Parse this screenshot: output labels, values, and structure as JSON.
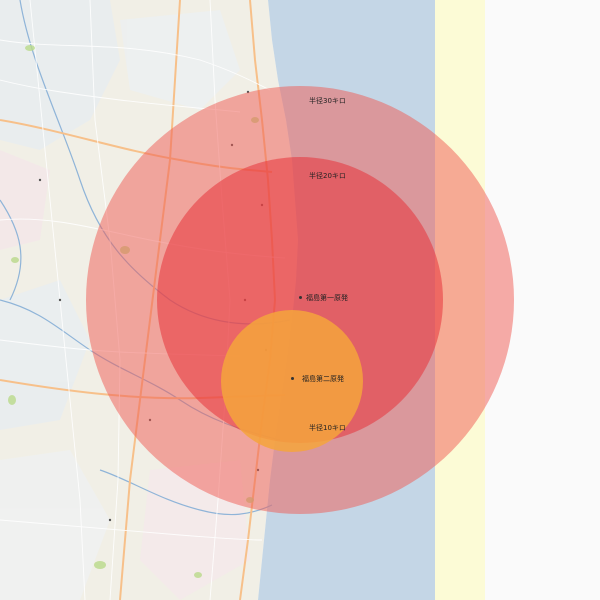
{
  "map": {
    "colors": {
      "land": "#f1efe6",
      "sea": "#c4d6e6",
      "strip": "#fcfbd6",
      "outer_margin": "#fafafa",
      "ring_30km": "#ef5a52",
      "ring_20km": "#e8333b",
      "ring_10km": "#f5a53c",
      "roads_major": "#f7c08a",
      "roads_minor": "#ffffff",
      "rivers": "#8fb4d8",
      "green_spots": "#b9d98a"
    },
    "labels": {
      "radius_30km": "半径30キロ",
      "radius_20km": "半径20キロ",
      "radius_10km": "半径10キロ"
    },
    "plants": {
      "daiichi": "福島第一原発",
      "daini": "福島第二原発"
    },
    "credit": ""
  }
}
